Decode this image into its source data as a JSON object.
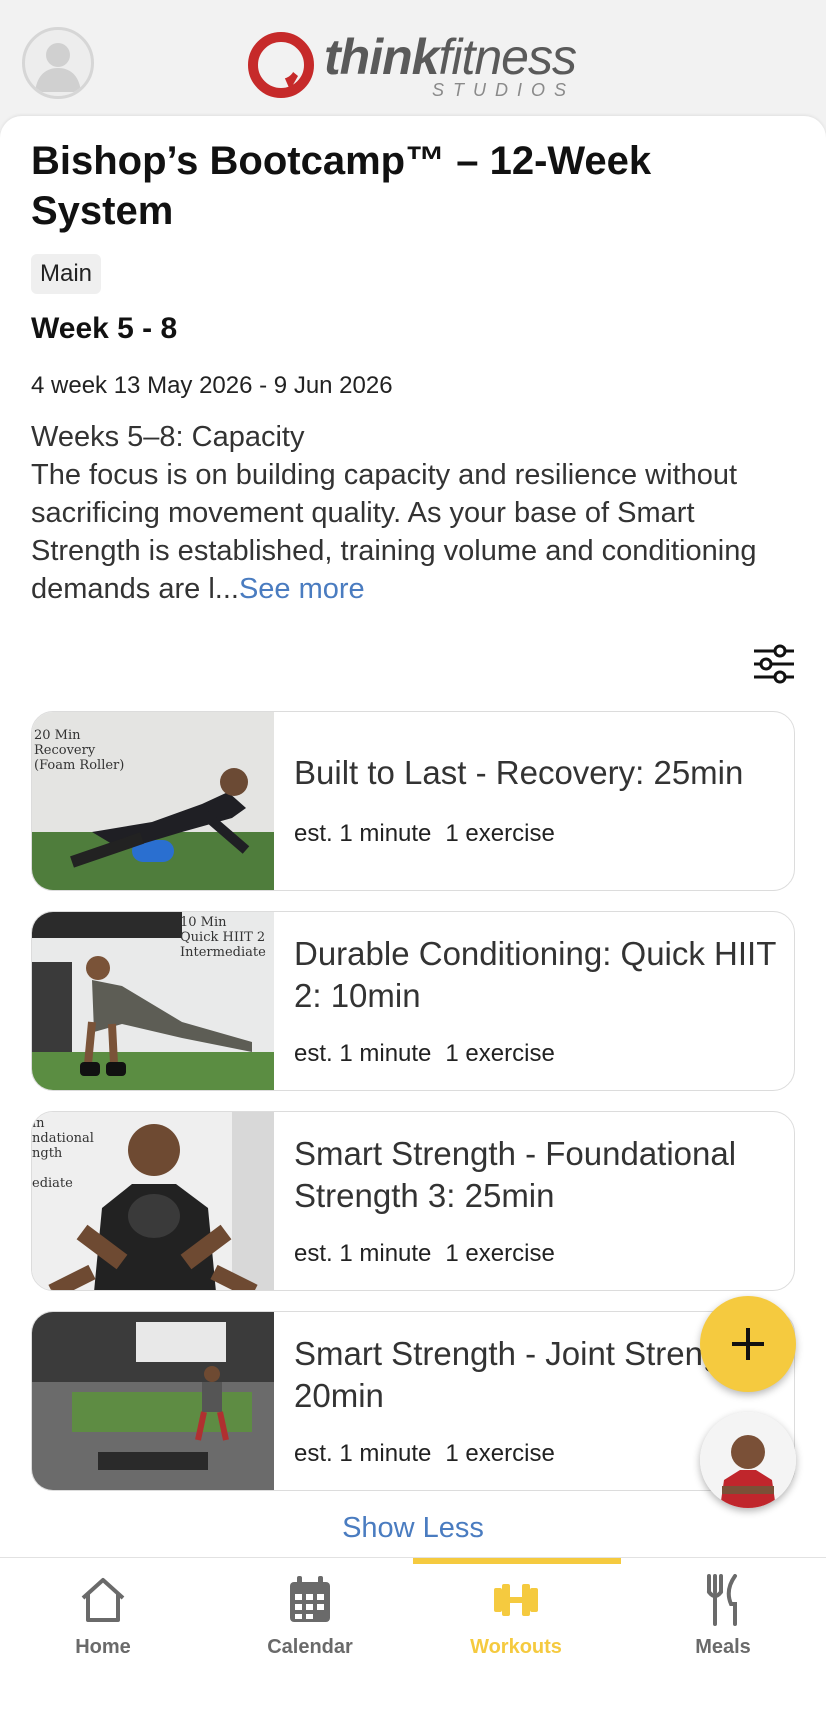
{
  "brand": {
    "name_bold": "think",
    "name_rest": "fitness",
    "sub": "STUDIOS",
    "accent": "#c62a2a"
  },
  "program": {
    "title": "Bishop’s Bootcamp™ – 12-Week System",
    "chip": "Main",
    "week_title": "Week 5 - 8",
    "date_range": "4 week 13 May 2026 - 9 Jun 2026",
    "description": "Weeks 5–8: Capacity\nThe focus is on building capacity and resilience without sacrificing movement quality. As your base of Smart Strength is established, training volume and conditioning demands are l...",
    "see_more": "See more"
  },
  "workouts": [
    {
      "title": "Built to Last - Recovery: 25min",
      "duration": "est. 1 minute",
      "exercises": "1 exercise",
      "thumb_caption": "20 Min\nRecovery\n(Foam Roller)"
    },
    {
      "title": "Durable Conditioning: Quick HIIT 2: 10min",
      "duration": "est. 1 minute",
      "exercises": "1 exercise",
      "thumb_caption": "10 Min\nQuick HIIT 2\nIntermediate"
    },
    {
      "title": "Smart Strength - Foundational Strength 3: 25min",
      "duration": "est. 1 minute",
      "exercises": "1 exercise",
      "thumb_caption": "in\nndational\nngth\n\nediate"
    },
    {
      "title": "Smart Strength - Joint Strength: 20min",
      "duration": "est. 1 minute",
      "exercises": "1 exercise",
      "thumb_caption": ""
    }
  ],
  "show_less": "Show Less",
  "fab": {
    "add_symbol": "+",
    "accent": "#f5ca3f"
  },
  "tabs": [
    {
      "label": "Home",
      "icon": "home-icon",
      "active": false
    },
    {
      "label": "Calendar",
      "icon": "calendar-icon",
      "active": false
    },
    {
      "label": "Workouts",
      "icon": "dumbbell-icon",
      "active": true
    },
    {
      "label": "Meals",
      "icon": "fork-knife-icon",
      "active": false
    }
  ]
}
